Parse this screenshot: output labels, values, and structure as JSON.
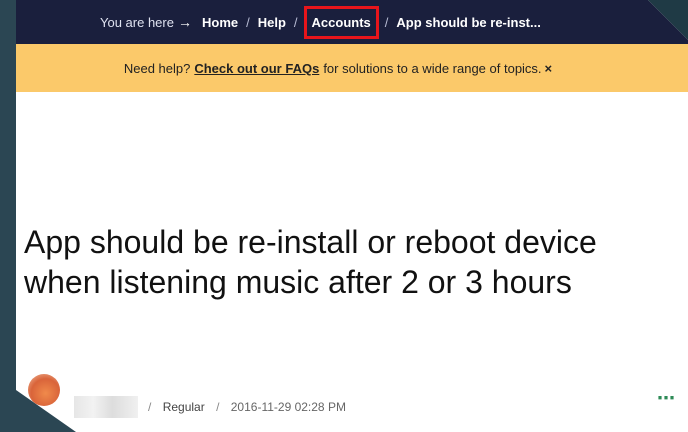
{
  "breadcrumb": {
    "prefix": "You are here",
    "arrow": "→",
    "items": [
      {
        "label": "Home"
      },
      {
        "label": "Help"
      },
      {
        "label": "Accounts"
      },
      {
        "label": "App should be re-inst..."
      }
    ],
    "separator": "/",
    "highlight_color": "#e8151b"
  },
  "notice": {
    "lead": "Need help?",
    "link": "Check out our FAQs",
    "tail": "for solutions to a wide range of topics.",
    "close": "×",
    "background": "#fbc96a"
  },
  "post": {
    "title": "App should be re-install or reboot device when listening music after 2 or 3 hours",
    "rank": "Regular",
    "date": "2016-11-29 02:28 PM",
    "more": "⋯",
    "separator": "/"
  },
  "colors": {
    "header": "#1a1f3d",
    "accent_dots": "#2e8b57"
  }
}
